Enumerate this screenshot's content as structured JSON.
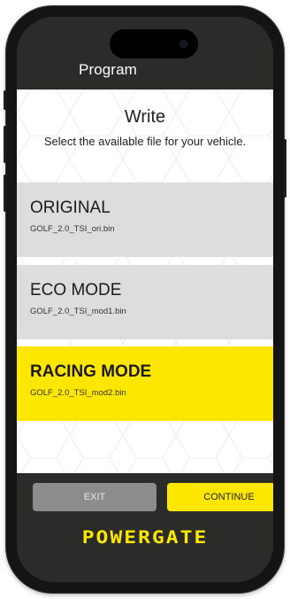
{
  "header": {
    "title": "Program"
  },
  "write": {
    "title": "Write",
    "subtitle": "Select the available file for your vehicle."
  },
  "options": [
    {
      "name": "ORIGINAL",
      "file": "GOLF_2.0_TSI_ori.bin",
      "selected": false
    },
    {
      "name": "ECO MODE",
      "file": "GOLF_2.0_TSI_mod1.bin",
      "selected": false
    },
    {
      "name": "RACING MODE",
      "file": "GOLF_2.0_TSI_mod2.bin",
      "selected": true
    }
  ],
  "buttons": {
    "exit": "EXIT",
    "continue": "CONTINUE"
  },
  "brand": {
    "logo": "POWERGATE"
  },
  "colors": {
    "accent": "#fde701",
    "header_bg": "#2b2b29",
    "option_bg": "#dddddd",
    "exit_bg": "#8c8c8c"
  }
}
